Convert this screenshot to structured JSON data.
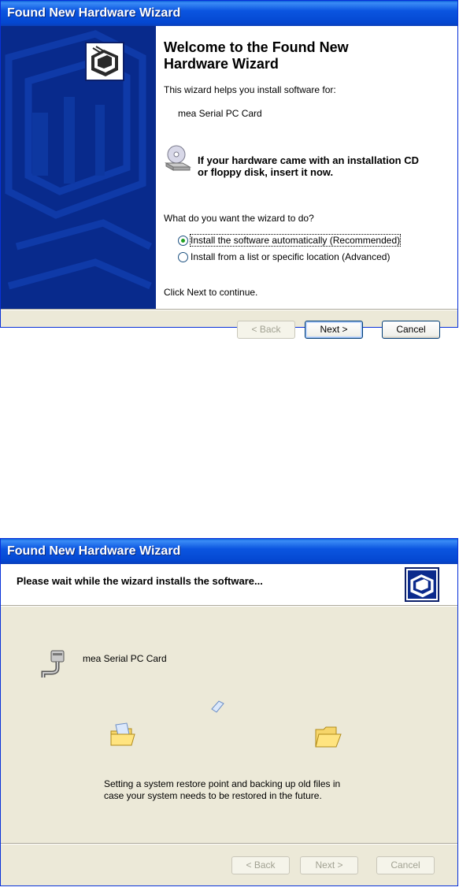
{
  "wizard1": {
    "title": "Found New Hardware Wizard",
    "heading_line1": "Welcome to the Found New",
    "heading_line2": "Hardware Wizard",
    "intro": "This wizard helps you install software for:",
    "device": "mea Serial PC Card",
    "cd_line1": "If your hardware came with an installation CD",
    "cd_line2": "or floppy disk, insert it now.",
    "question": "What do you want the wizard to do?",
    "options": [
      {
        "label": "Install the software automatically (Recommended)",
        "selected": true
      },
      {
        "label": "Install from a list or specific location (Advanced)",
        "selected": false
      }
    ],
    "footer_hint": "Click Next to continue.",
    "buttons": {
      "back": "< Back",
      "next": "Next >",
      "cancel": "Cancel"
    }
  },
  "wizard2": {
    "title": "Found New Hardware Wizard",
    "header": "Please wait while the wizard installs the software...",
    "device": "mea Serial PC Card",
    "status_line1": "Setting a system restore point and backing up old files in",
    "status_line2": "case your system needs to be restored in the future.",
    "buttons": {
      "back": "< Back",
      "next": "Next >",
      "cancel": "Cancel"
    }
  },
  "colors": {
    "title_blue": "#0b55e0",
    "side_panel": "#082a8c",
    "dialog_bg": "#ece9d8",
    "radio_dot": "#21a121"
  }
}
